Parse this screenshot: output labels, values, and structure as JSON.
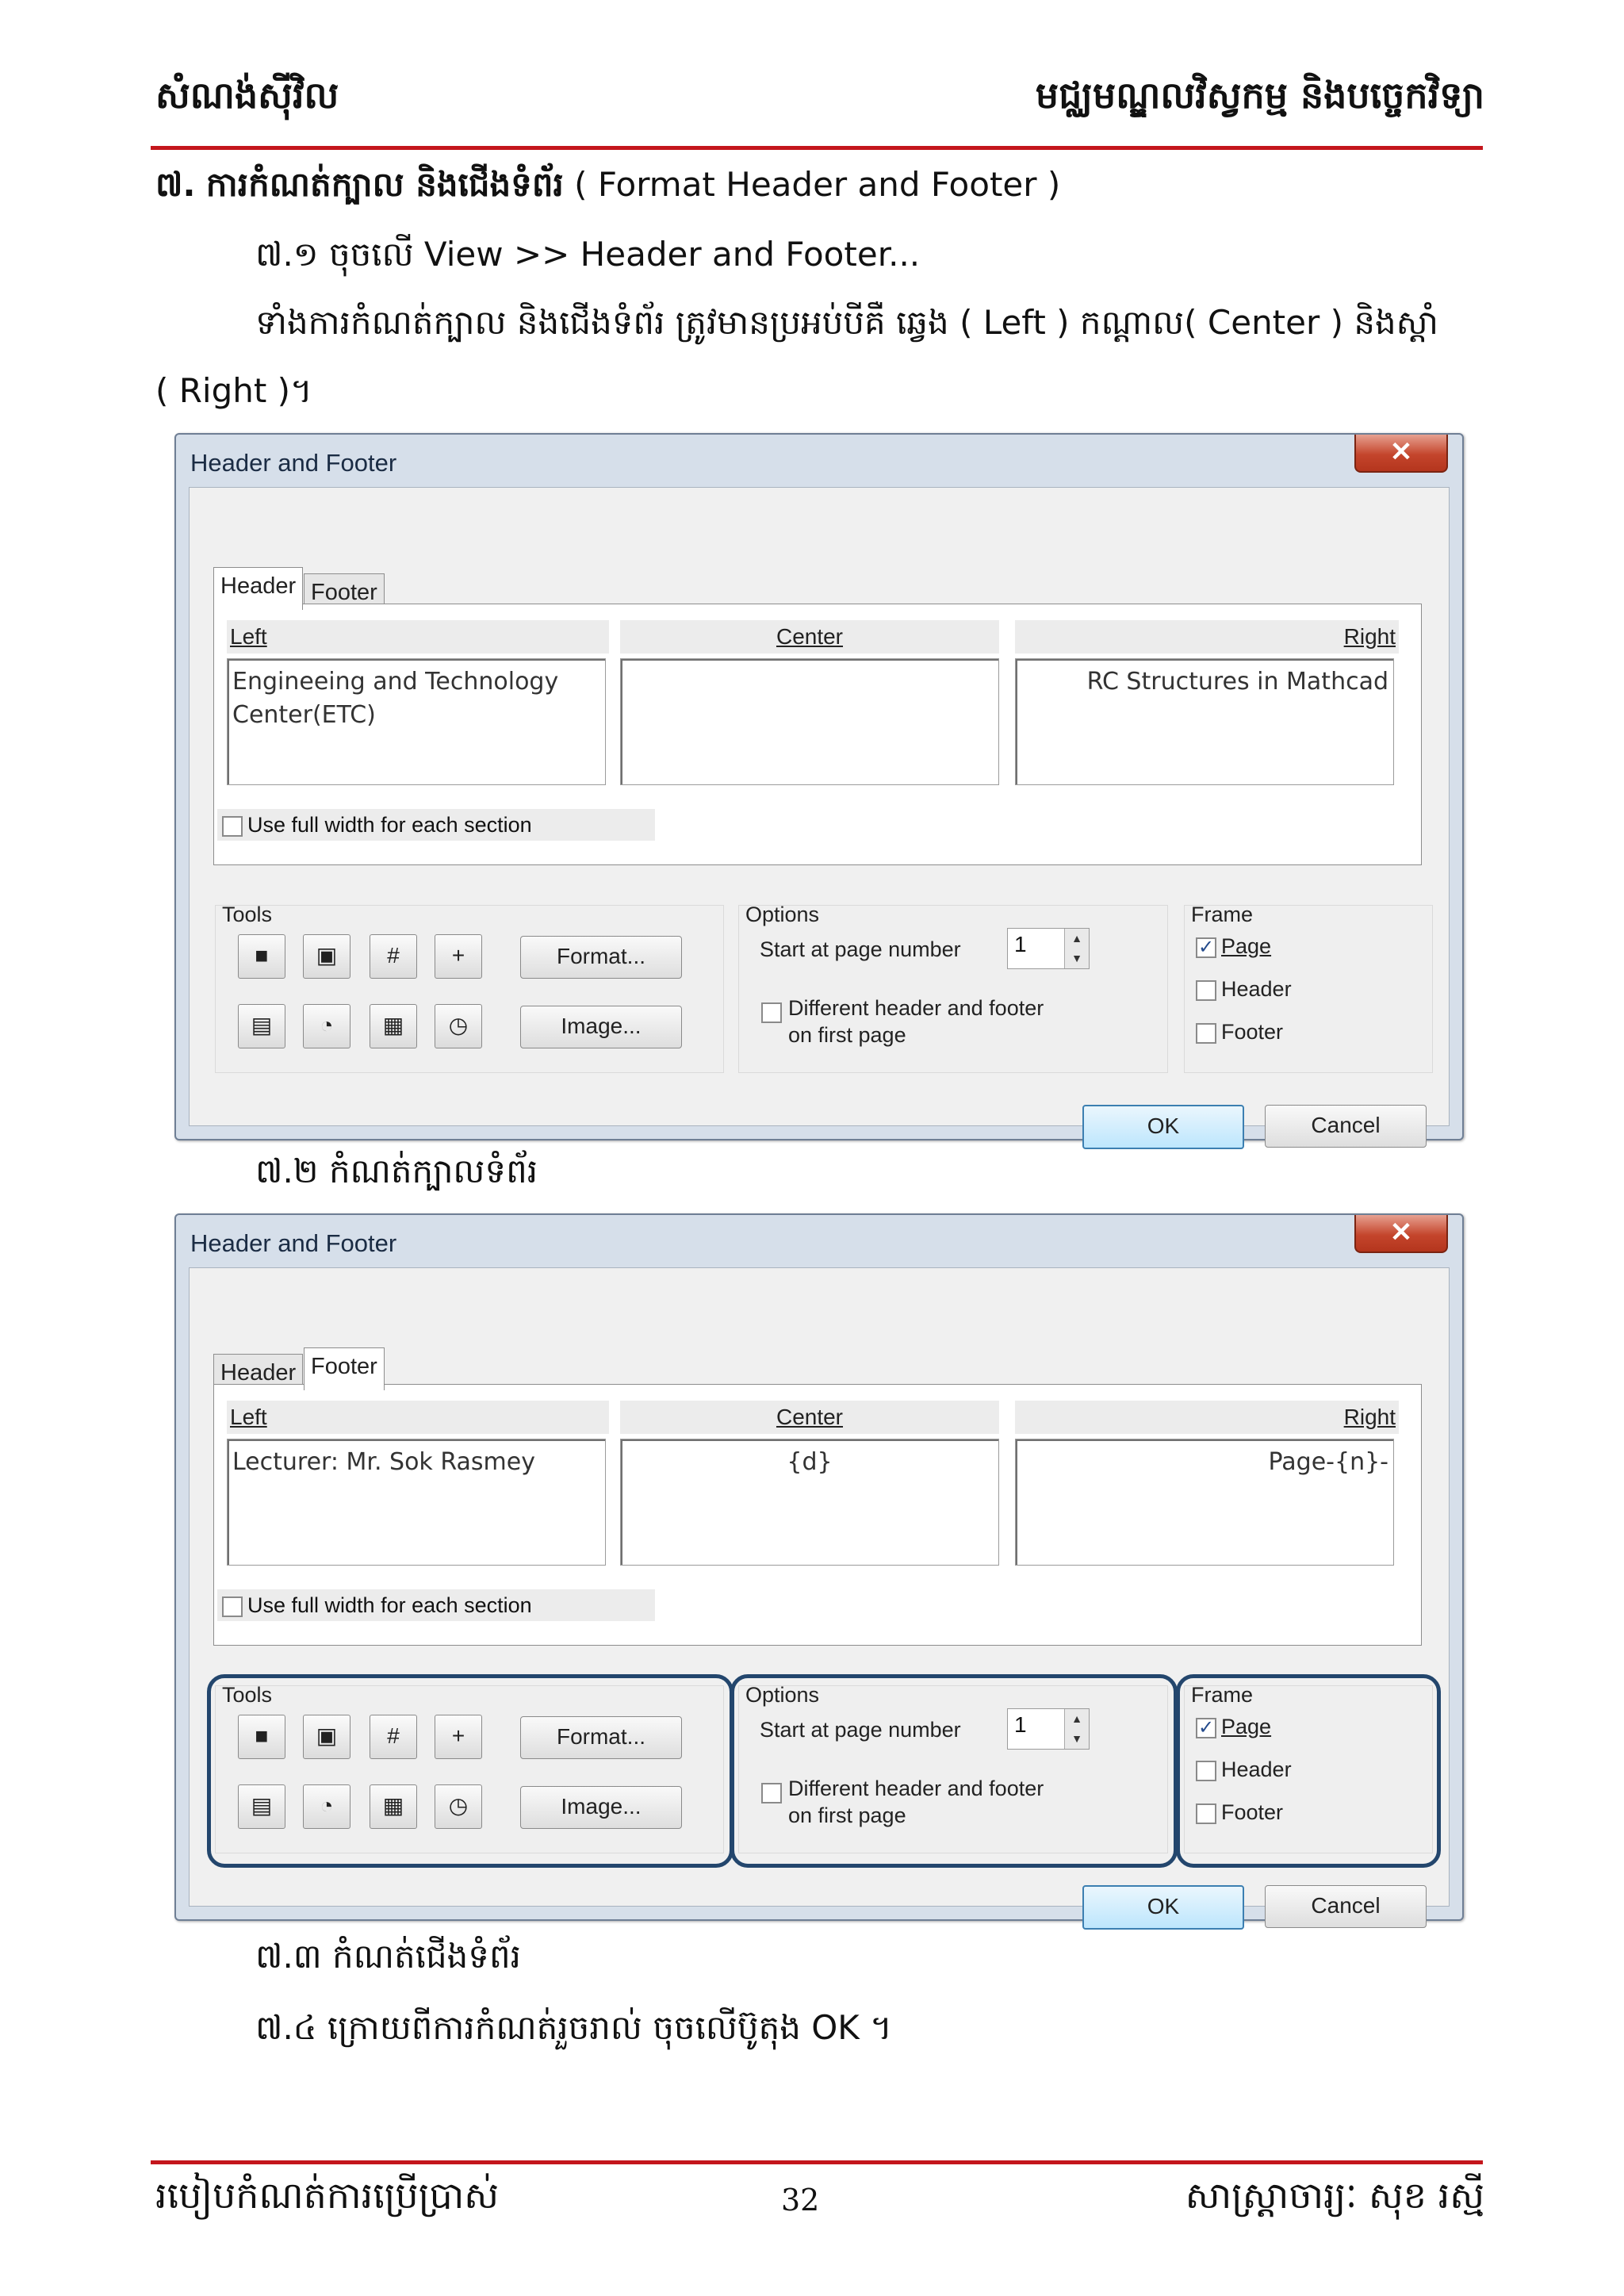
{
  "page_header": {
    "left": "សំណង់ស៊ីវិល",
    "right": "មជ្ឈមណ្ឌលវិស្វកម្ម និងបច្ចេកវិទ្យា"
  },
  "heading": {
    "number": "៧.",
    "title_kh": "ការកំណត់ក្បាល និងជើងទំព័រ",
    "title_en": " ( Format Header and Footer )"
  },
  "body": {
    "step1": "៧.១ ចុចលើ View >> Header and Footer...",
    "para1": "ទាំងការកំណត់ក្បាល និងជើងទំព័រ ត្រូវមានប្រអប់បីគឺ ឆ្វេង ( Left ) កណ្ដាល( Center ) និងស្ដាំ",
    "para2": "( Right )។",
    "step2": "៧.២ កំណត់ក្បាលទំព័រ",
    "step3": "៧.៣ កំណត់ជើងទំព័រ",
    "step4": "៧.៤ ក្រោយពីការកំណត់រួចរាល់ ចុចលើប៊ូតុង OK ។"
  },
  "dialogs": [
    {
      "title": "Header and Footer",
      "close": "✕",
      "tabs": [
        "Header",
        "Footer"
      ],
      "active_tab": "Header",
      "sections": {
        "left_label": "Left",
        "center_label": "Center",
        "right_label": "Right",
        "left_text": "Engineeing and Technology\nCenter(ETC)",
        "center_text": "",
        "right_text": "RC Structures in Mathcad"
      },
      "full_width_label": "Use full width for each section",
      "tools_label": "Tools",
      "format_button": "Format...",
      "image_button": "Image...",
      "options_label": "Options",
      "start_page_label": "Start at page number",
      "start_page_value": "1",
      "different_first_label": "Different header and footer\non first page",
      "frame_label": "Frame",
      "frame_page": "Page",
      "frame_header": "Header",
      "frame_footer": "Footer",
      "ok": "OK",
      "cancel": "Cancel"
    },
    {
      "title": "Header and Footer",
      "close": "✕",
      "tabs": [
        "Header",
        "Footer"
      ],
      "active_tab": "Footer",
      "sections": {
        "left_label": "Left",
        "center_label": "Center",
        "right_label": "Right",
        "left_text": "Lecturer: Mr. Sok Rasmey",
        "center_text": "{d}",
        "right_text": "Page-{n}-"
      },
      "full_width_label": "Use full width for each section",
      "tools_label": "Tools",
      "format_button": "Format...",
      "image_button": "Image...",
      "options_label": "Options",
      "start_page_label": "Start at page number",
      "start_page_value": "1",
      "different_first_label": "Different header and footer\non first page",
      "frame_label": "Frame",
      "frame_page": "Page",
      "frame_header": "Header",
      "frame_footer": "Footer",
      "ok": "OK",
      "cancel": "Cancel"
    }
  ],
  "page_footer": {
    "left": "របៀបកំណត់ការប្រើប្រាស់",
    "page_number": "32",
    "right": "សាស្ត្រាចារ្យៈ សុខ រស្មី"
  },
  "colors": {
    "rule": "#c4161c",
    "highlight": "#23466d"
  }
}
